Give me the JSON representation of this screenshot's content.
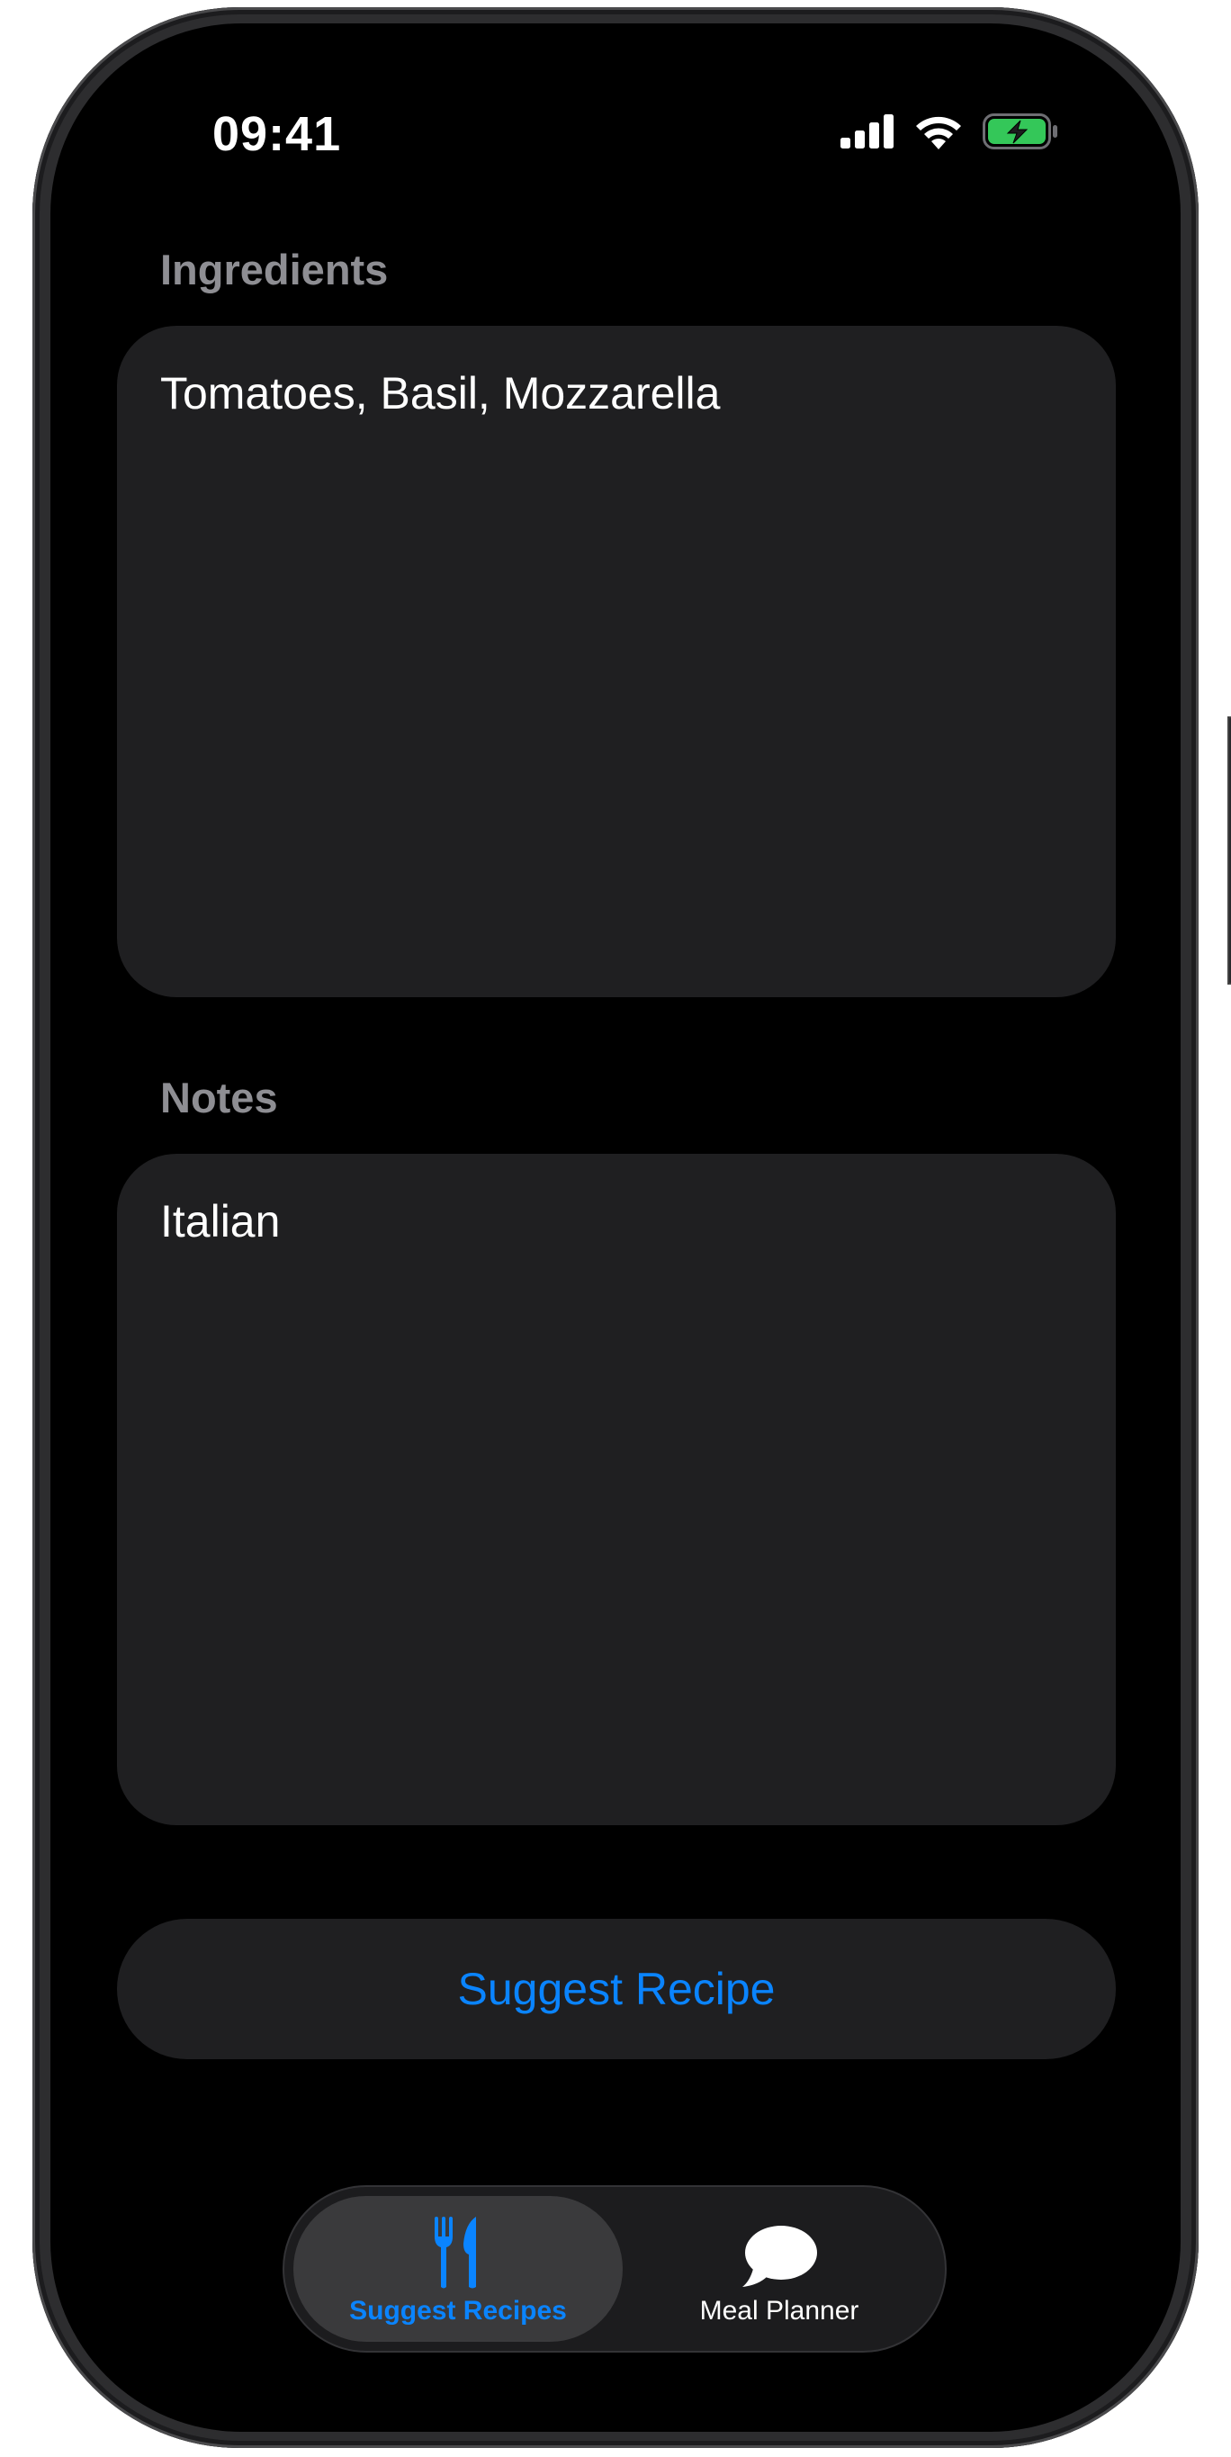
{
  "status_bar": {
    "time": "09:41"
  },
  "form": {
    "ingredients": {
      "label": "Ingredients",
      "value": "Tomatoes, Basil, Mozzarella"
    },
    "notes": {
      "label": "Notes",
      "value": "Italian"
    },
    "submit_label": "Suggest Recipe"
  },
  "tab_bar": {
    "tabs": [
      {
        "label": "Suggest Recipes",
        "icon": "fork-knife-icon",
        "selected": true
      },
      {
        "label": "Meal Planner",
        "icon": "speech-bubble-icon",
        "selected": false
      }
    ]
  },
  "colors": {
    "accent": "#0a84ff",
    "background": "#000000",
    "card": "#1f1f21",
    "secondary_label": "#8e8e93",
    "battery": "#34c759"
  }
}
